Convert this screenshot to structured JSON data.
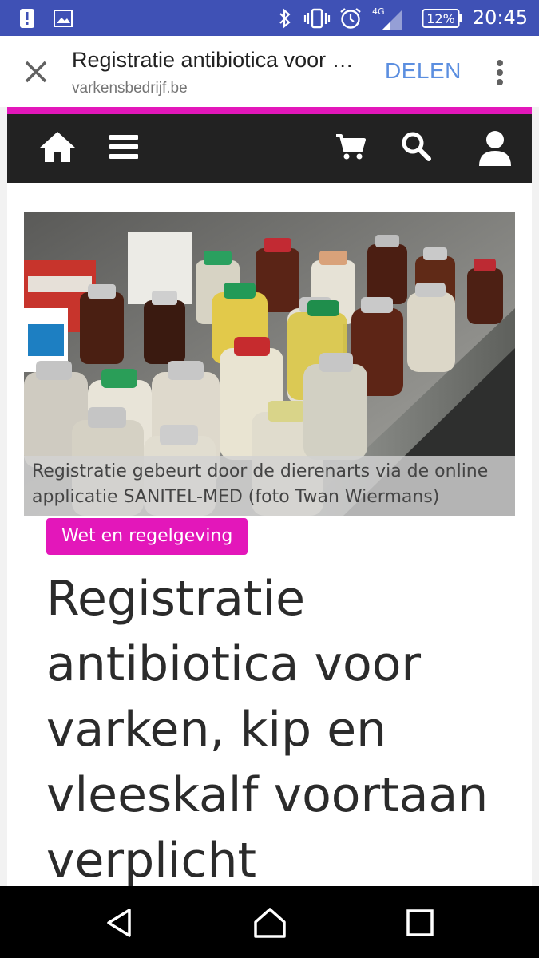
{
  "status_bar": {
    "time": "20:45",
    "battery": "12%",
    "network": "4G",
    "icons": [
      "alert-icon",
      "image-icon",
      "bluetooth-icon",
      "vibrate-icon",
      "alarm-icon",
      "signal-icon",
      "battery-icon"
    ]
  },
  "app_bar": {
    "title": "Registratie antibiotica voor varken, kip en vleeskalf voortaan verplicht",
    "url": "varkensbedrijf.be",
    "share_label": "DELEN"
  },
  "site_nav": {
    "accent": "#e317ba",
    "icons": [
      "home-icon",
      "menu-icon",
      "cart-icon",
      "search-icon",
      "user-icon"
    ]
  },
  "article": {
    "photo_caption": "Registratie gebeurt door de dierenarts via de online applicatie SANITEL-MED (foto Twan Wiermans)",
    "category": "Wet en regelgeving",
    "headline": "Registratie antibiotica voor varken, kip en vleeskalf voortaan verplicht"
  },
  "nav_bar": {
    "icons": [
      "back-icon",
      "home-icon",
      "recents-icon"
    ]
  }
}
